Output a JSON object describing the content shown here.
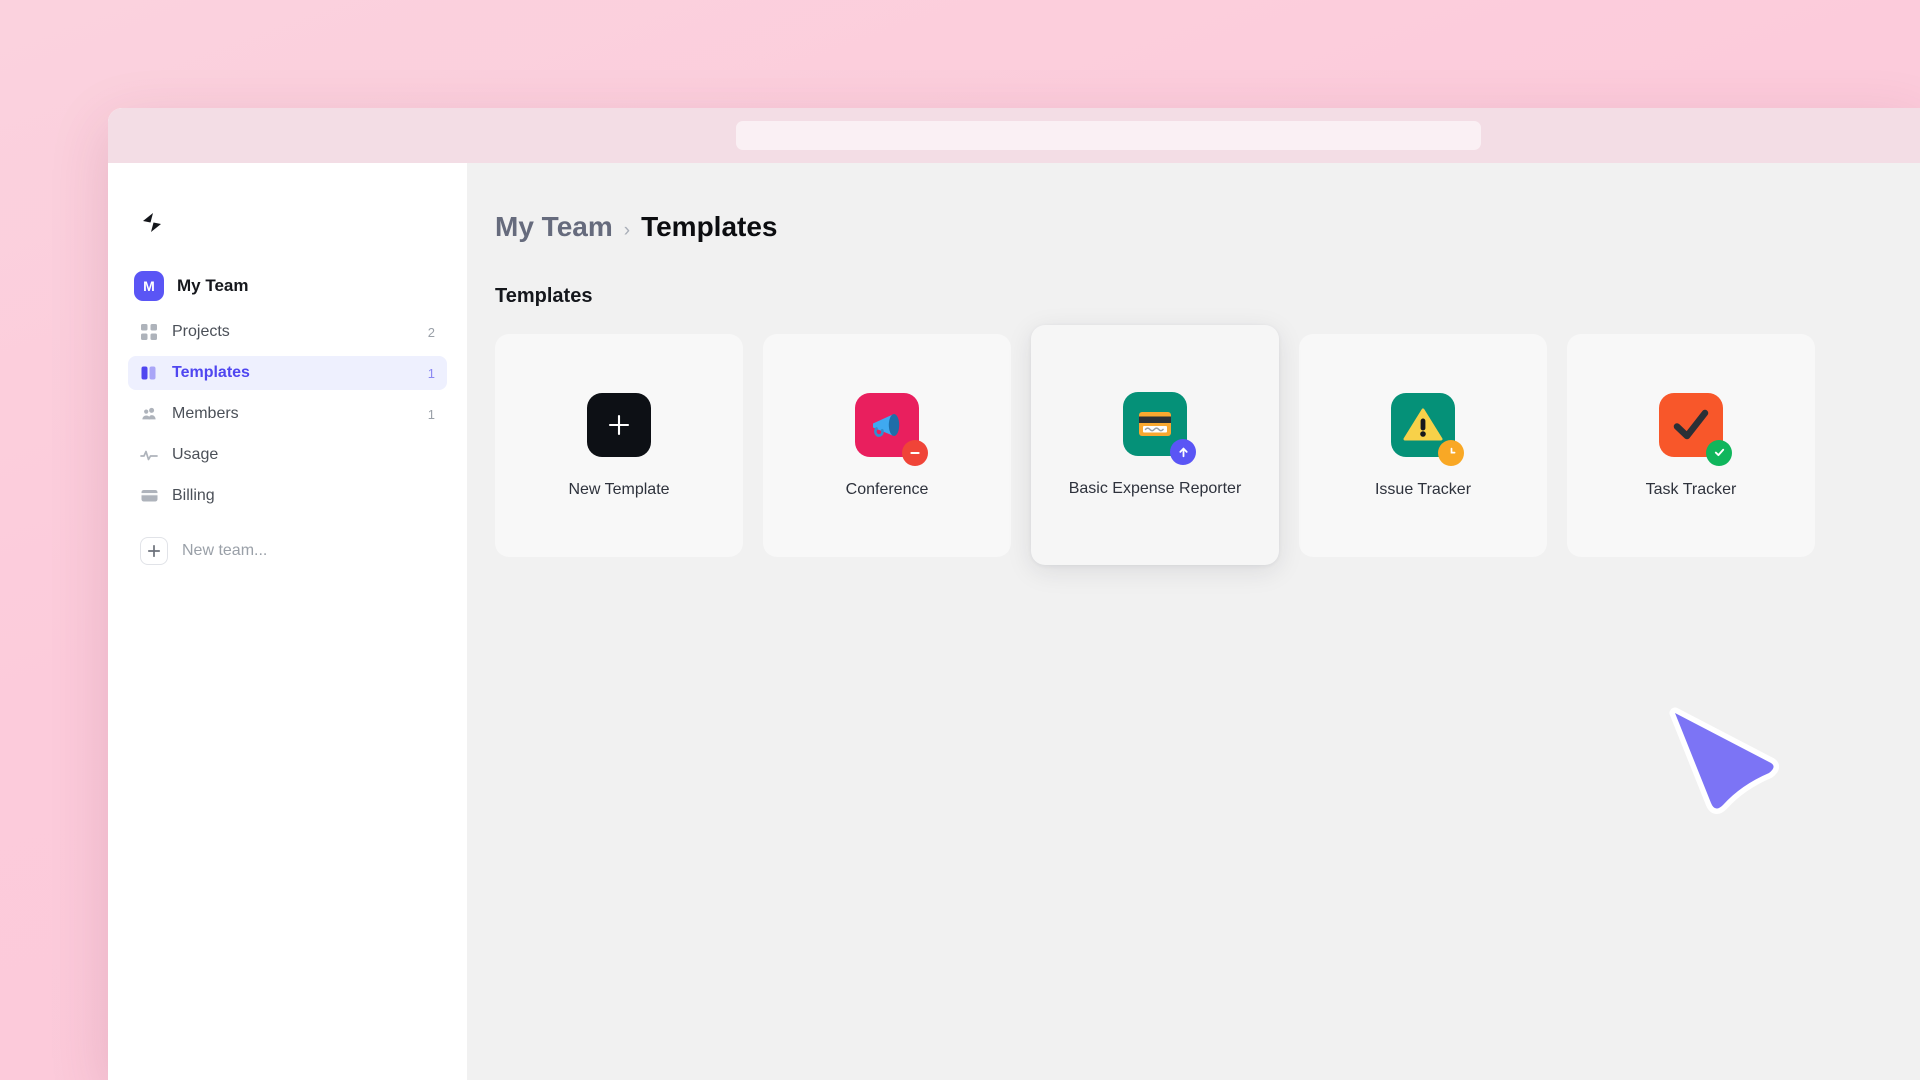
{
  "browser": {
    "url_bar_value": "",
    "url_bar_placeholder": ""
  },
  "sidebar": {
    "logo_name": "spark-logo",
    "team": {
      "initial": "M",
      "name": "My Team"
    },
    "items": [
      {
        "label": "Projects",
        "count": "2",
        "icon": "grid-icon",
        "active": false
      },
      {
        "label": "Templates",
        "count": "1",
        "icon": "columns-icon",
        "active": true
      },
      {
        "label": "Members",
        "count": "1",
        "icon": "people-icon",
        "active": false
      },
      {
        "label": "Usage",
        "count": "",
        "icon": "pulse-icon",
        "active": false
      },
      {
        "label": "Billing",
        "count": "",
        "icon": "card-icon",
        "active": false
      }
    ],
    "new_team_label": "New team...",
    "new_team_icon": "plus-icon"
  },
  "breadcrumb": {
    "team": "My Team",
    "separator": "›",
    "current": "Templates"
  },
  "main": {
    "section_title": "Templates",
    "cards": [
      {
        "label": "New Template",
        "icon": "plus-tile-icon",
        "badge": ""
      },
      {
        "label": "Conference",
        "icon": "megaphone-icon",
        "badge": "minus-badge"
      },
      {
        "label": "Basic Expense Reporter",
        "icon": "credit-card-icon",
        "badge": "upload-badge"
      },
      {
        "label": "Issue Tracker",
        "icon": "warning-icon",
        "badge": "clock-badge"
      },
      {
        "label": "Task Tracker",
        "icon": "checkmark-icon",
        "badge": "check-badge"
      }
    ]
  },
  "colors": {
    "accent": "#4f46f0",
    "active_nav_bg": "#eef0fe",
    "browser_chrome": "#f3dde5",
    "page_bg": "#fbcbda",
    "conference_tile": "#e91f5e",
    "expense_tile": "#059178",
    "issue_tile": "#059178",
    "task_tile": "#f8572a",
    "new_template_tile": "#0d1015",
    "badge_minus": "#f04438",
    "badge_upload": "#5a55f5",
    "badge_clock": "#f9a825",
    "badge_check": "#10b65c",
    "cursor": "#7c74f5"
  },
  "cursor": {
    "name": "mouse-pointer"
  }
}
